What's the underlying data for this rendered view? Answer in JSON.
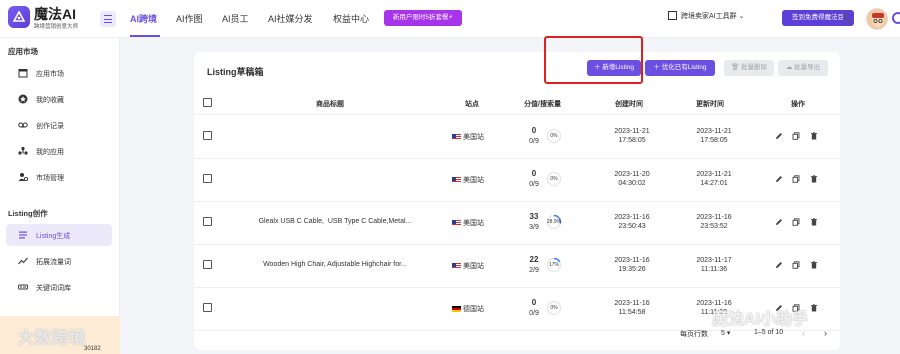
{
  "header": {
    "logo_title": "魔法AI",
    "logo_subtitle": "跨境营销创意大师",
    "nav": [
      "AI跨境",
      "AI作图",
      "AI员工",
      "AI社媒分发",
      "权益中心"
    ],
    "promo_label": "新用户限时5折套餐⚡",
    "group_label": "跨境卖家AI工具群",
    "free_button": "签到免费得魔法豆",
    "accent_color": "#6b4fe0"
  },
  "sidebar": {
    "section1": "应用市场",
    "items1": [
      {
        "label": "应用市场",
        "icon": "storefront-icon"
      },
      {
        "label": "我的收藏",
        "icon": "star-icon"
      },
      {
        "label": "创作记录",
        "icon": "voicemail-icon"
      },
      {
        "label": "我的应用",
        "icon": "apps-icon"
      },
      {
        "label": "市场管理",
        "icon": "user-manage-icon"
      }
    ],
    "section2": "Listing创作",
    "items2": [
      {
        "label": "Listing生成",
        "icon": "list-icon",
        "active": true
      },
      {
        "label": "拓展流量词",
        "icon": "trend-icon"
      },
      {
        "label": "关键词词库",
        "icon": "keyword-icon"
      }
    ],
    "badge_text": "大数跨境",
    "badge_count": "30182"
  },
  "card": {
    "title": "Listing草稿箱",
    "buttons": {
      "add": "新增Listing",
      "optimize": "优化已有Listing",
      "batch_delete": "批量删除",
      "batch_export": "批量导出"
    },
    "columns": [
      "商品标题",
      "站点",
      "分值/搜索量",
      "创建时间",
      "更新时间",
      "操作"
    ],
    "rows": [
      {
        "title": "",
        "site": "美国站",
        "flag": "us",
        "score": "0",
        "search": "0/9",
        "pct": "0%",
        "pct_value": 0,
        "created_date": "2023-11-21",
        "created_time": "17:58:05",
        "updated_date": "2023-11-21",
        "updated_time": "17:58:05"
      },
      {
        "title": "",
        "site": "美国站",
        "flag": "us",
        "score": "0",
        "search": "0/9",
        "pct": "0%",
        "pct_value": 0,
        "created_date": "2023-11-20",
        "created_time": "04:30:02",
        "updated_date": "2023-11-21",
        "updated_time": "14:27:01"
      },
      {
        "title": "Glealx USB C Cable,  USB Type C Cable,Metal...",
        "site": "美国站",
        "flag": "us",
        "score": "33",
        "search": "3/9",
        "pct": "28.9%",
        "pct_value": 0.289,
        "created_date": "2023-11-16",
        "created_time": "23:50:43",
        "updated_date": "2023-11-16",
        "updated_time": "23:53:52"
      },
      {
        "title": "Wooden High Chair, Adjustable Highchair for...",
        "site": "美国站",
        "flag": "us",
        "score": "22",
        "search": "2/9",
        "pct": "17%",
        "pct_value": 0.17,
        "created_date": "2023-11-16",
        "created_time": "19:35:26",
        "updated_date": "2023-11-17",
        "updated_time": "11:11:36"
      },
      {
        "title": "",
        "site": "德国站",
        "flag": "de",
        "score": "0",
        "search": "0/9",
        "pct": "0%",
        "pct_value": 0,
        "created_date": "2023-11-16",
        "created_time": "11:54:58",
        "updated_date": "2023-11-16",
        "updated_time": "11:11:59"
      }
    ],
    "footer": {
      "rows_per_page_label": "每页行数",
      "rows_per_page": "5",
      "range": "1–5 of 10"
    }
  },
  "watermark": "魔法AI小助手"
}
